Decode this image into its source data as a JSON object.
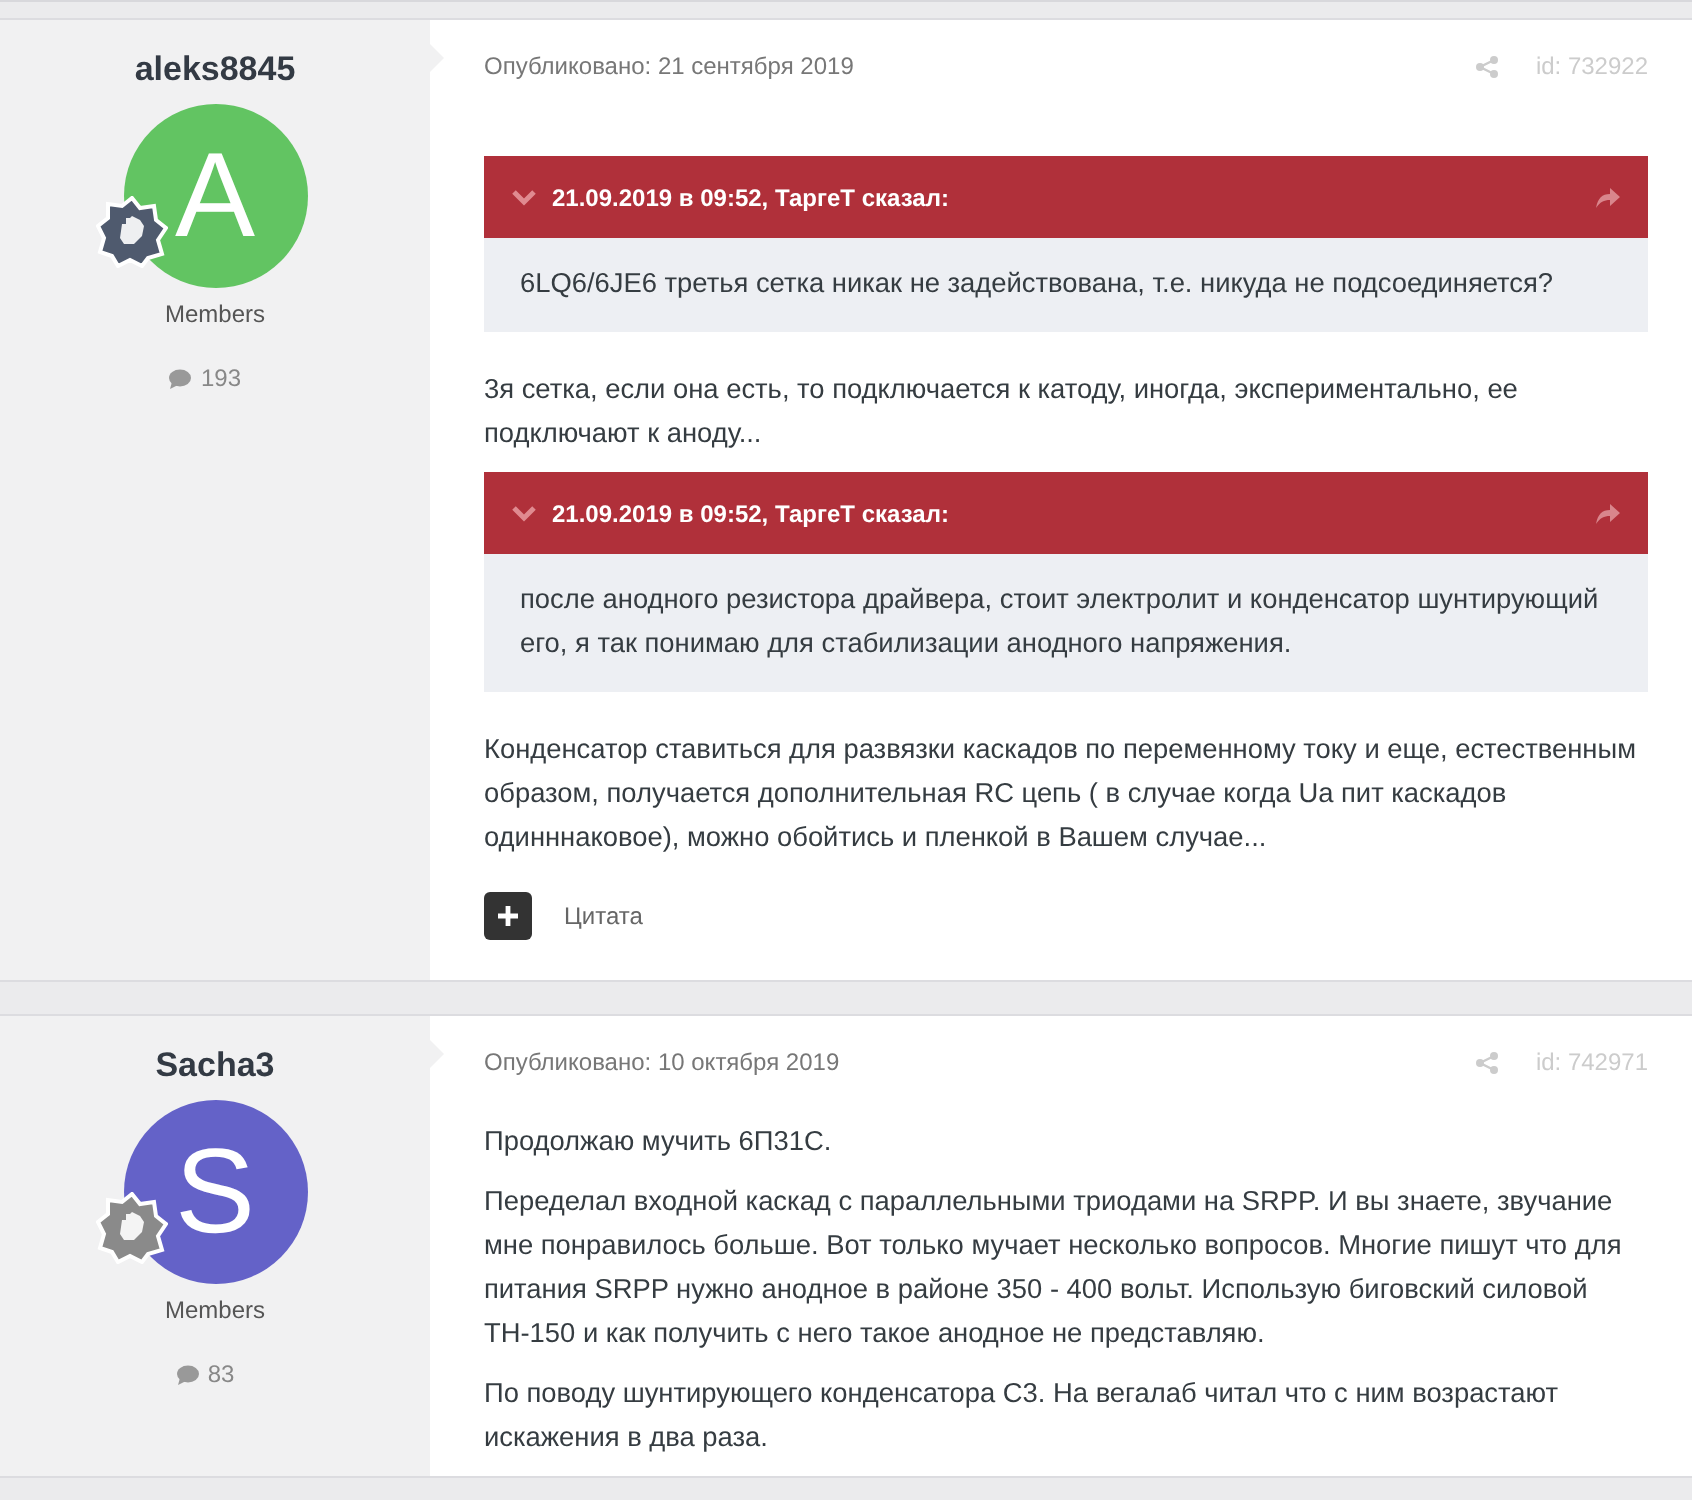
{
  "posts": [
    {
      "author": "aleks8845",
      "avatar": {
        "letter": "A",
        "color": "#62c462"
      },
      "badge": {
        "color": "#4f5a6e"
      },
      "group": "Members",
      "post_count": "193",
      "date": "Опубликовано: 21 сентября 2019",
      "id": "id: 732922",
      "quote_action": "Цитата",
      "body": [
        {
          "kind": "quote",
          "header": "21.09.2019 в 09:52, ТаргеТ сказал:",
          "text": "6LQ6/6JE6 третья сетка никак не задействована, т.е. никуда не подсоединяется?"
        },
        {
          "kind": "paragraph",
          "text": "3я сетка, если она есть, то подключается к катоду, иногда,  экспериментально, ее подключают к аноду..."
        },
        {
          "kind": "quote",
          "header": "21.09.2019 в 09:52, ТаргеТ сказал:",
          "text": "после анодного резистора драйвера, стоит электролит и конденсатор шунтирующий его, я так понимаю для стабилизации анодного напряжения."
        },
        {
          "kind": "paragraph",
          "text": "Конденсатор ставиться для развязки каскадов по переменному току и еще, естественным образом, получается дополнительная RC цепь ( в случае когда Ua пит каскадов одинннаковое), можно обойтись и пленкой в Вашем случае..."
        }
      ]
    },
    {
      "author": "Sacha3",
      "avatar": {
        "letter": "S",
        "color": "#6462c8"
      },
      "badge": {
        "color": "#8a8a8a"
      },
      "group": "Members",
      "post_count": "83",
      "date": "Опубликовано: 10 октября 2019",
      "id": "id: 742971",
      "body": [
        {
          "kind": "paragraph",
          "text": "Продолжаю мучить 6П31С."
        },
        {
          "kind": "paragraph",
          "text": "Переделал входной каскад с параллельными триодами на SRPP. И вы знаете, звучание мне понравилось больше. Вот только мучает несколько вопросов. Многие пишут что для питания SRPP нужно анодное в районе 350 - 400 вольт. Использую биговский силовой ТН-150 и как получить с него такое анодное не представляю."
        },
        {
          "kind": "paragraph",
          "text": "По поводу шунтирующего конденсатора С3. На вегалаб читал что с ним возрастают искажения в два раза."
        }
      ]
    }
  ]
}
